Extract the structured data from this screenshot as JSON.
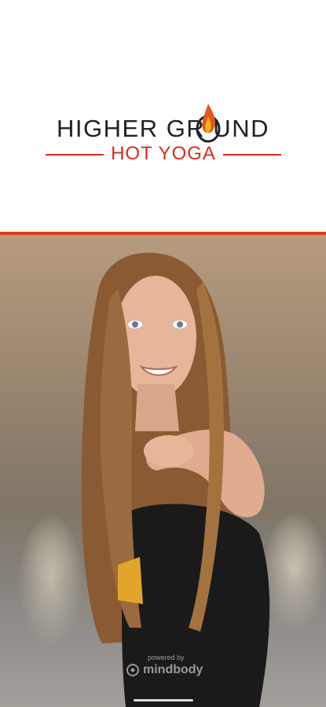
{
  "logo": {
    "line1": "HIGHER GR  UND",
    "line2": "HOT YOGA",
    "brand_color": "#d92a1c",
    "text_color": "#222222",
    "flame_icon": "flame-icon"
  },
  "accent_color": "#e23a1e",
  "photo": {
    "subject": "hero-photo"
  },
  "watermark": {
    "powered_label": "powered by",
    "brand_label": "mindbody"
  }
}
